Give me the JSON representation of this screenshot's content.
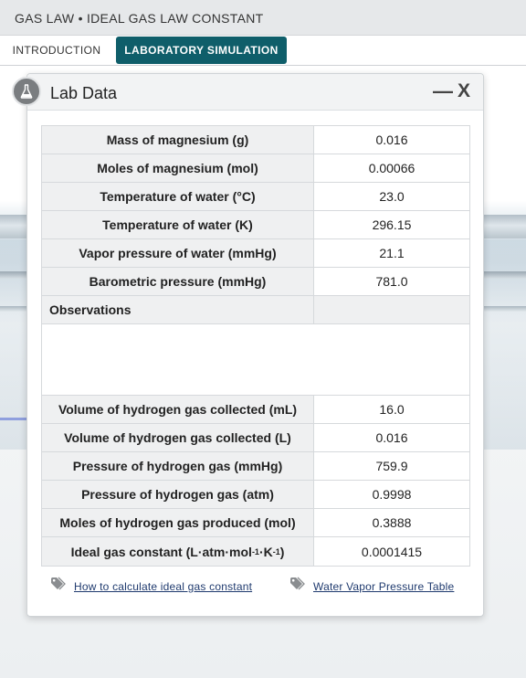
{
  "app": {
    "title": "GAS LAW • IDEAL GAS LAW CONSTANT"
  },
  "tabs": [
    {
      "label": "INTRODUCTION",
      "active": false
    },
    {
      "label": "LABORATORY SIMULATION",
      "active": true
    }
  ],
  "panel": {
    "title": "Lab Data",
    "minimize_label": "—",
    "close_label": "X",
    "icon": "flask-icon"
  },
  "table": {
    "rows_top": [
      {
        "label": "Mass of magnesium (g)",
        "value": "0.016"
      },
      {
        "label": "Moles of magnesium (mol)",
        "value": "0.00066"
      },
      {
        "label": "Temperature of water (°C)",
        "value": "23.0"
      },
      {
        "label": "Temperature of water (K)",
        "value": "296.15"
      },
      {
        "label": "Vapor pressure of water (mmHg)",
        "value": "21.1"
      },
      {
        "label": "Barometric pressure (mmHg)",
        "value": "781.0"
      }
    ],
    "observations_label": "Observations",
    "rows_bottom": [
      {
        "label": "Volume of hydrogen gas collected (mL)",
        "value": "16.0"
      },
      {
        "label": "Volume of hydrogen gas collected (L)",
        "value": "0.016"
      },
      {
        "label": "Pressure of hydrogen gas (mmHg)",
        "value": "759.9"
      },
      {
        "label": "Pressure of hydrogen gas (atm)",
        "value": "0.9998"
      },
      {
        "label": "Moles of hydrogen gas produced (mol)",
        "value": "0.3888"
      }
    ],
    "constant_row": {
      "label_prefix": "Ideal gas constant (L·atm·mol",
      "exp1": "-1",
      "label_mid": "·K",
      "exp2": "-1",
      "label_suffix": ")",
      "value": "0.0001415"
    }
  },
  "links": [
    {
      "label": "How to calculate ideal gas constant",
      "icon": "tag-icon"
    },
    {
      "label": "Water Vapor Pressure Table",
      "icon": "tag-icon"
    }
  ],
  "colors": {
    "accent": "#0f5e6a",
    "link": "#1f3a6e"
  }
}
